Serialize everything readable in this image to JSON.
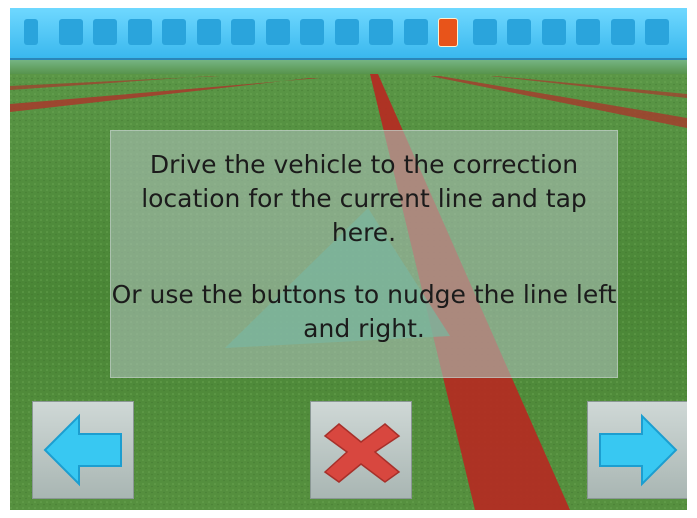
{
  "lightbar": {
    "segments": 19,
    "active_segment": 12,
    "colors": {
      "background": "#4cc3f5",
      "segment": "#2aa4dc",
      "active": "#e8541a"
    }
  },
  "instructions": {
    "line1": "Drive the vehicle to the correction location for the current line and tap here.",
    "line2": "Or use the buttons to nudge the line left and right."
  },
  "buttons": {
    "nudge_left": {
      "icon": "arrow-left-icon",
      "color": "#38c8f2"
    },
    "cancel": {
      "icon": "close-icon",
      "color": "#d8473f"
    },
    "nudge_right": {
      "icon": "arrow-right-icon",
      "color": "#38c8f2"
    }
  },
  "colors": {
    "grass": "#4f8a3d",
    "guidance_line": "#b52a22"
  }
}
